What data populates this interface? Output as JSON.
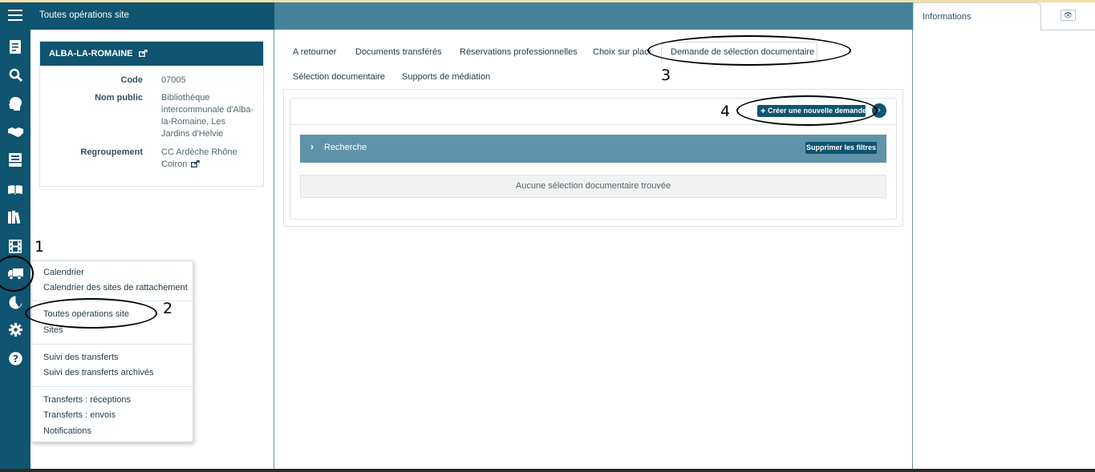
{
  "header": {
    "title": "Toutes opérations site"
  },
  "info_panel": {
    "title": "Informations",
    "toggle_icon": "eye-icon"
  },
  "rail_icons": [
    "menu-icon",
    "document-icon",
    "search-icon",
    "head-icon",
    "handshake-icon",
    "tray-icon",
    "open-book-icon",
    "books-icon",
    "film-icon",
    "truck-icon",
    "pie-chart-icon",
    "gear-icon",
    "help-icon"
  ],
  "site_card": {
    "name": "ALBA-LA-ROMAINE",
    "code_label": "Code",
    "code_value": "07005",
    "public_name_label": "Nom public",
    "public_name_value": "Bibliothèque intercommunale d'Alba-la-Romaine, Les Jardins d'Helvie",
    "group_label": "Regroupement",
    "group_value": "CC Ardèche Rhône Coiron"
  },
  "menu": {
    "items": [
      "Calendrier",
      "Calendrier des sites de rattachement",
      "Toutes opérations site",
      "Sites",
      "Suivi des transferts",
      "Suivi des transferts archivés",
      "Transferts : réceptions",
      "Transferts : envois",
      "Notifications"
    ]
  },
  "tabs": [
    "A retourner",
    "Documents transférés",
    "Réservations professionnelles",
    "Choix sur place",
    "Demande de sélection documentaire",
    "Sélection documentaire",
    "Supports de médiation"
  ],
  "active_tab": "Demande de sélection documentaire",
  "main": {
    "create_button": "Créer une nouvelle demande",
    "search_label": "Recherche",
    "clear_filters_button": "Supprimer les filtres",
    "empty_message": "Aucune sélection documentaire trouvée"
  },
  "annotations": [
    "1",
    "2",
    "3",
    "4"
  ],
  "colors": {
    "dark_teal": "#0f5470",
    "header_mid": "#45829a",
    "search_bar": "#5f93a9"
  }
}
